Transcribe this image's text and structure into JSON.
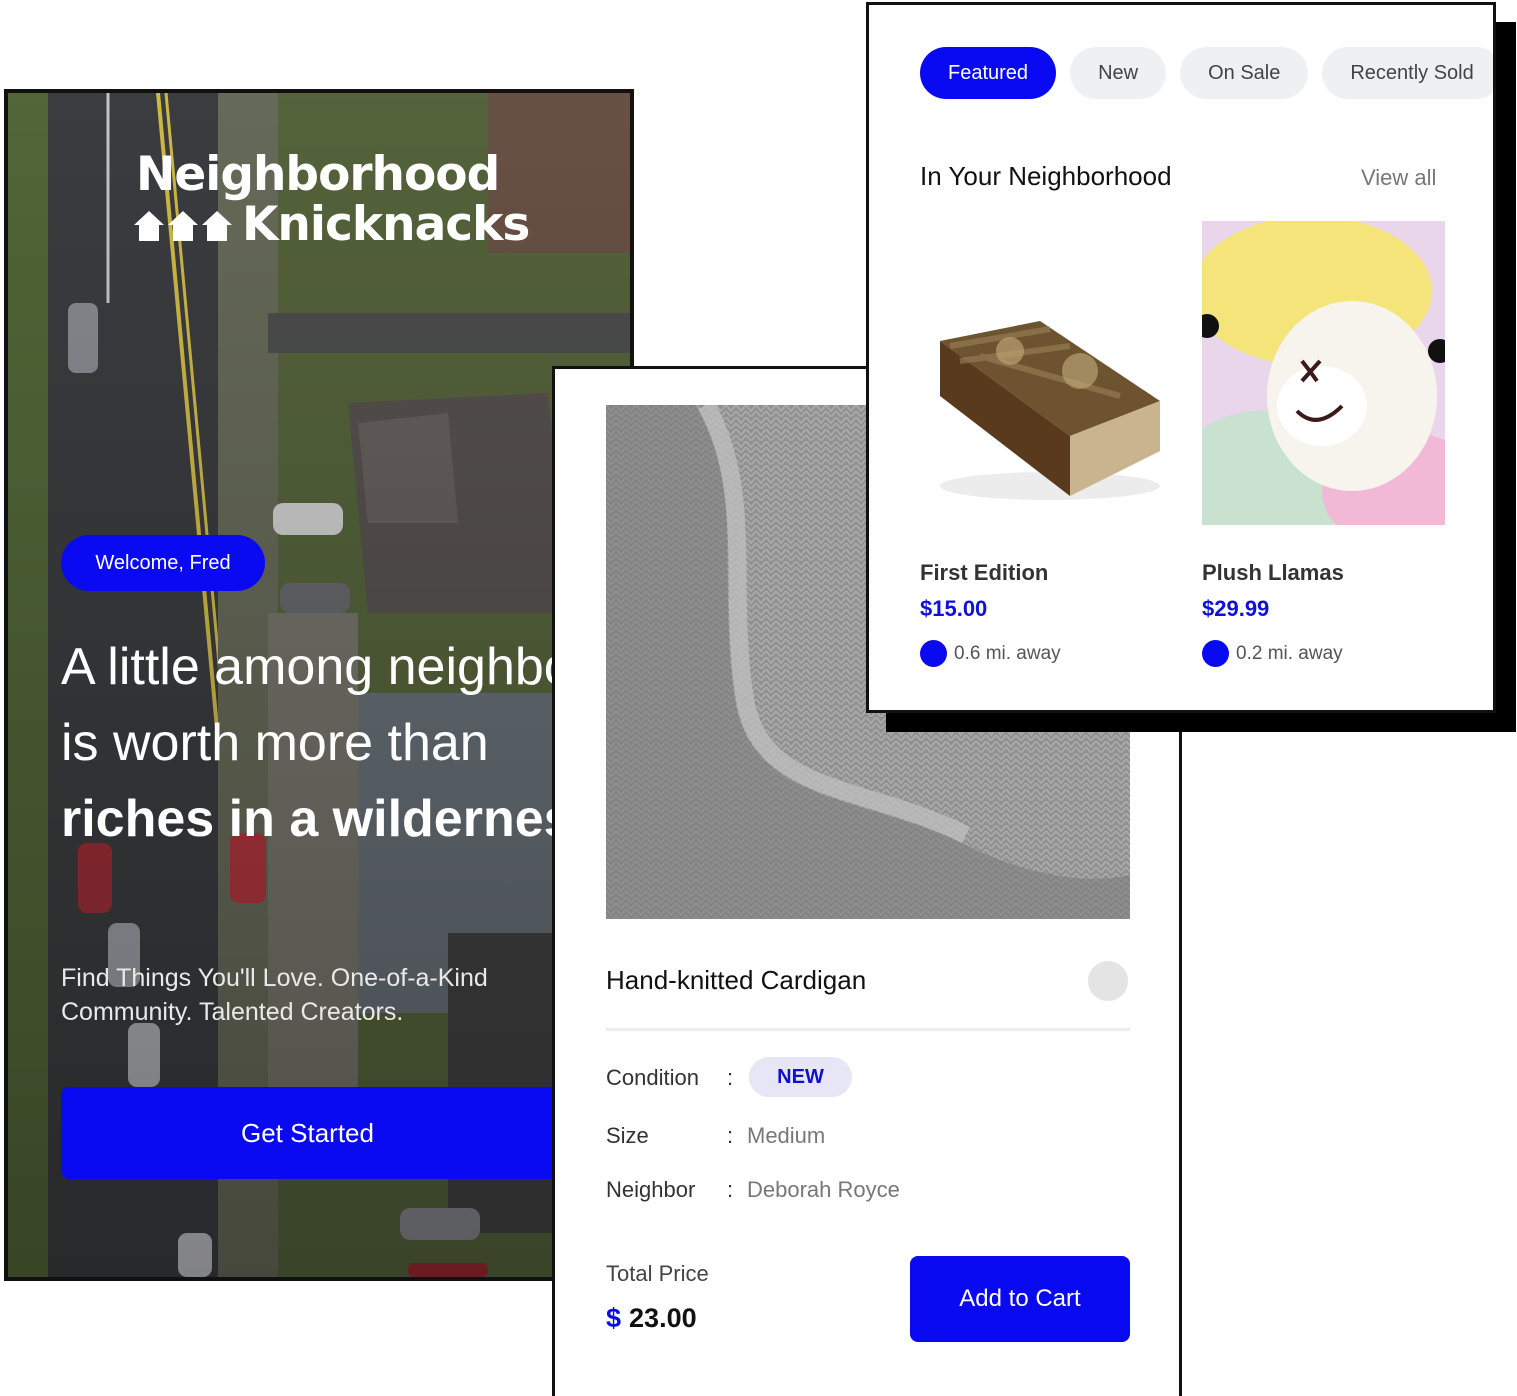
{
  "brand": {
    "logo_line1": "Neighborhood",
    "logo_line2": "Knicknacks"
  },
  "hero": {
    "welcome": "Welcome, Fred",
    "headline_part1": "A little among neighbors is worth more than ",
    "headline_bold": "riches in a wilderness.",
    "subline": "Find Things You'll Love. One-of-a-Kind Community. Talented Creators.",
    "cta": "Get Started"
  },
  "detail": {
    "title": "Hand-knitted Cardigan",
    "specs": {
      "condition_label": "Condition",
      "condition_value": "NEW",
      "size_label": "Size",
      "size_value": "Medium",
      "neighbor_label": "Neighbor",
      "neighbor_value": "Deborah Royce",
      "separator": ":"
    },
    "total_label": "Total Price",
    "currency": "$",
    "total_value": "23.00",
    "add_to_cart": "Add to Cart"
  },
  "browse": {
    "tabs": [
      {
        "label": "Featured",
        "active": true
      },
      {
        "label": "New",
        "active": false
      },
      {
        "label": "On Sale",
        "active": false
      },
      {
        "label": "Recently Sold",
        "active": false
      }
    ],
    "section_title": "In Your Neighborhood",
    "view_all": "View all",
    "items": [
      {
        "name": "First Edition",
        "price": "$15.00",
        "distance": "0.6 mi. away",
        "image": "old-book"
      },
      {
        "name": "Plush Llamas",
        "price": "$29.99",
        "distance": "0.2 mi. away",
        "image": "plush-llama"
      }
    ]
  },
  "colors": {
    "accent": "#0a0af2",
    "badge_bg": "#e6e6f6",
    "tab_bg": "#eef0f2"
  }
}
